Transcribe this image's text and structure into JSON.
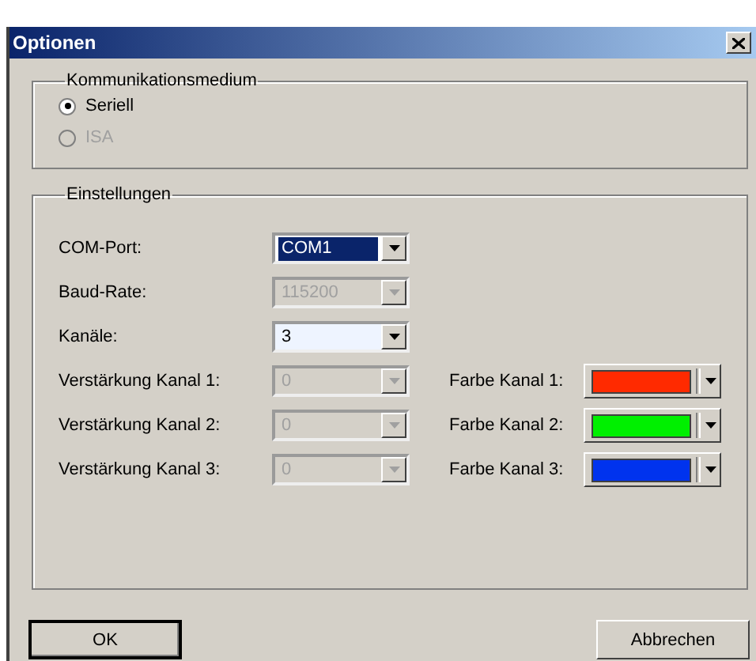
{
  "window": {
    "title": "Optionen"
  },
  "medium": {
    "title": "Kommunikationsmedium",
    "options": [
      {
        "label": "Seriell",
        "selected": true,
        "disabled": false
      },
      {
        "label": "ISA",
        "selected": false,
        "disabled": true
      }
    ]
  },
  "settings": {
    "title": "Einstellungen",
    "fields": [
      {
        "label": "COM-Port:",
        "value": "COM1",
        "disabled": false,
        "focused": true,
        "hovered": false
      },
      {
        "label": "Baud-Rate:",
        "value": "115200",
        "disabled": true,
        "focused": false,
        "hovered": false
      },
      {
        "label": "Kanäle:",
        "value": "3",
        "disabled": false,
        "focused": false,
        "hovered": true
      }
    ],
    "channels": [
      {
        "gain_label": "Verstärkung Kanal 1:",
        "gain_value": "0",
        "gain_disabled": true,
        "color_label": "Farbe Kanal 1:",
        "color": "#ff2a00"
      },
      {
        "gain_label": "Verstärkung Kanal 2:",
        "gain_value": "0",
        "gain_disabled": true,
        "color_label": "Farbe Kanal 2:",
        "color": "#00f000"
      },
      {
        "gain_label": "Verstärkung Kanal 3:",
        "gain_value": "0",
        "gain_disabled": true,
        "color_label": "Farbe Kanal 3:",
        "color": "#0033ee"
      }
    ]
  },
  "buttons": [
    {
      "label": "OK",
      "default": true
    },
    {
      "label": "Abbrechen",
      "default": false
    }
  ]
}
